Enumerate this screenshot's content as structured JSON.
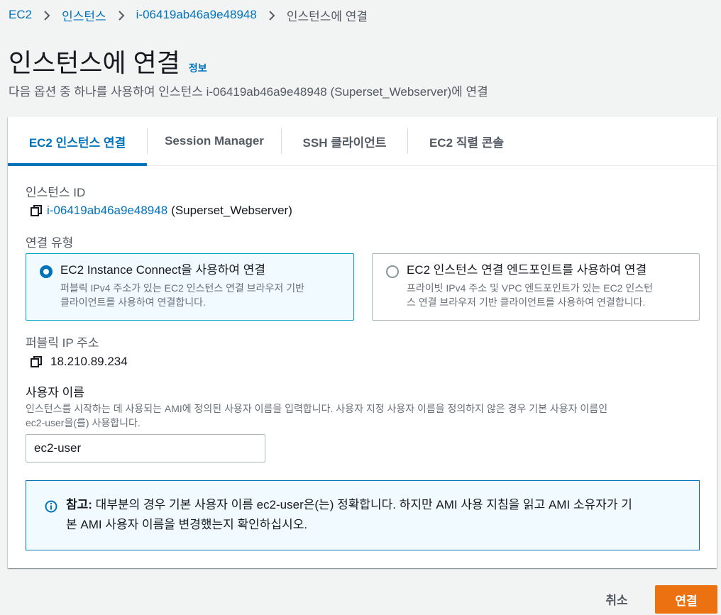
{
  "breadcrumb": {
    "items": [
      "EC2",
      "인스턴스",
      "i-06419ab46a9e48948"
    ],
    "current": "인스턴스에 연결"
  },
  "page": {
    "title": "인스턴스에 연결",
    "info_link": "정보",
    "subtitle": "다음 옵션 중 하나를 사용하여 인스턴스 i-06419ab46a9e48948 (Superset_Webserver)에 연결"
  },
  "tabs": [
    {
      "label": "EC2 인스턴스 연결",
      "active": true
    },
    {
      "label": "Session Manager",
      "active": false
    },
    {
      "label": "SSH 클라이언트",
      "active": false
    },
    {
      "label": "EC2 직렬 콘솔",
      "active": false
    }
  ],
  "instance": {
    "label": "인스턴스 ID",
    "id": "i-06419ab46a9e48948",
    "name": "(Superset_Webserver)"
  },
  "connection_type": {
    "label": "연결 유형",
    "options": [
      {
        "title": "EC2 Instance Connect을 사용하여 연결",
        "desc_line1": "퍼블릭 IPv4 주소가 있는 EC2 인스턴스 연결 브라우저 기반",
        "desc_line2": "클라이언트를 사용하여 연결합니다.",
        "selected": true
      },
      {
        "title": "EC2 인스턴스 연결 엔드포인트를 사용하여 연결",
        "desc_line1": "프라이빗 IPv4 주소 및 VPC 엔드포인트가 있는 EC2 인스턴",
        "desc_line2": "스 연결 브라우저 기반 클라이언트를 사용하여 연결합니다.",
        "selected": false
      }
    ]
  },
  "public_ip": {
    "label": "퍼블릭 IP 주소",
    "value": "18.210.89.234"
  },
  "username": {
    "label": "사용자 이름",
    "desc_line1": "인스턴스를 시작하는 데 사용되는 AMI에 정의된 사용자 이름을 입력합니다. 사용자 지정 사용자 이름을 정의하지 않은 경우 기본 사용자 이름인",
    "desc_line2": "ec2-user을(를) 사용합니다.",
    "value": "ec2-user"
  },
  "alert": {
    "bold": "참고:",
    "text_line1": " 대부분의 경우 기본 사용자 이름 ec2-user은(는) 정확합니다. 하지만 AMI 사용 지침을 읽고 AMI 소유자가 기",
    "text_line2": "본 AMI 사용자 이름을 변경했는지 확인하십시오."
  },
  "footer": {
    "cancel_label": "취소",
    "connect_label": "연결"
  },
  "colors": {
    "link": "#0073bb",
    "primary_button": "#ec7211",
    "selected_border": "#00a1c9",
    "selected_bg": "#f1faff"
  },
  "icons": {
    "copy": "copy-icon",
    "info": "info-icon",
    "chevron": "chevron-right-icon"
  }
}
